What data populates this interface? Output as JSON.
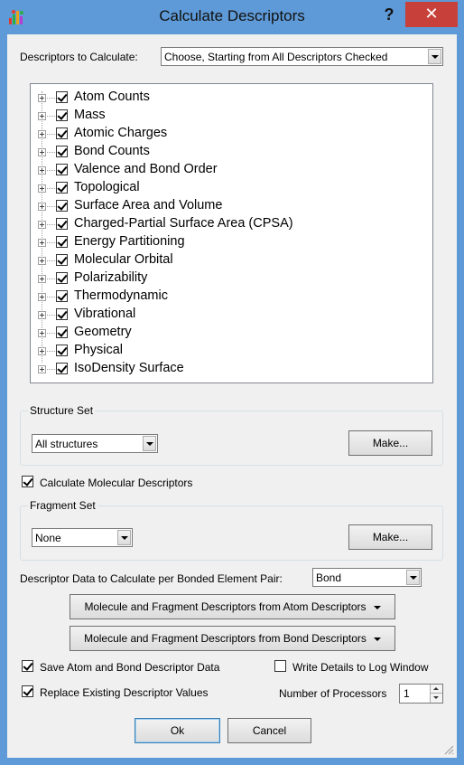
{
  "window": {
    "title": "Calculate Descriptors",
    "help_label": "?",
    "close_label": "✕",
    "app_icon": "bar-chart-app-icon"
  },
  "descriptors": {
    "label": "Descriptors to Calculate:",
    "selected": "Choose, Starting from All Descriptors Checked",
    "tree": [
      {
        "label": "Atom Counts",
        "checked": true
      },
      {
        "label": "Mass",
        "checked": true
      },
      {
        "label": "Atomic Charges",
        "checked": true
      },
      {
        "label": "Bond Counts",
        "checked": true
      },
      {
        "label": "Valence and Bond Order",
        "checked": true
      },
      {
        "label": "Topological",
        "checked": true
      },
      {
        "label": "Surface Area and Volume",
        "checked": true
      },
      {
        "label": "Charged-Partial Surface Area (CPSA)",
        "checked": true
      },
      {
        "label": "Energy Partitioning",
        "checked": true
      },
      {
        "label": "Molecular Orbital",
        "checked": true
      },
      {
        "label": "Polarizability",
        "checked": true
      },
      {
        "label": "Thermodynamic",
        "checked": true
      },
      {
        "label": "Vibrational",
        "checked": true
      },
      {
        "label": "Geometry",
        "checked": true
      },
      {
        "label": "Physical",
        "checked": true
      },
      {
        "label": "IsoDensity Surface",
        "checked": true
      }
    ]
  },
  "structure_set": {
    "title": "Structure Set",
    "selected": "All structures",
    "make_label": "Make..."
  },
  "calc_molecular": {
    "label": "Calculate Molecular Descriptors",
    "checked": true
  },
  "fragment_set": {
    "title": "Fragment Set",
    "selected": "None",
    "make_label": "Make..."
  },
  "bonded_pair": {
    "label": "Descriptor Data to Calculate per Bonded Element Pair:",
    "selected": "Bond"
  },
  "menu_buttons": {
    "atom": "Molecule and Fragment Descriptors from Atom Descriptors",
    "bond": "Molecule and Fragment Descriptors from Bond Descriptors"
  },
  "options": {
    "save_atom_bond": {
      "label": "Save Atom and Bond Descriptor Data",
      "checked": true
    },
    "write_details": {
      "label": "Write Details to Log Window",
      "checked": false
    },
    "replace_existing": {
      "label": "Replace Existing Descriptor Values",
      "checked": true
    },
    "num_processors_label": "Number of Processors",
    "num_processors": "1"
  },
  "footer": {
    "ok_label": "Ok",
    "cancel_label": "Cancel"
  },
  "colors": {
    "title_bar": "#5e9ad7",
    "close_button": "#c7403a",
    "dialog_bg": "#f0f0f0"
  }
}
